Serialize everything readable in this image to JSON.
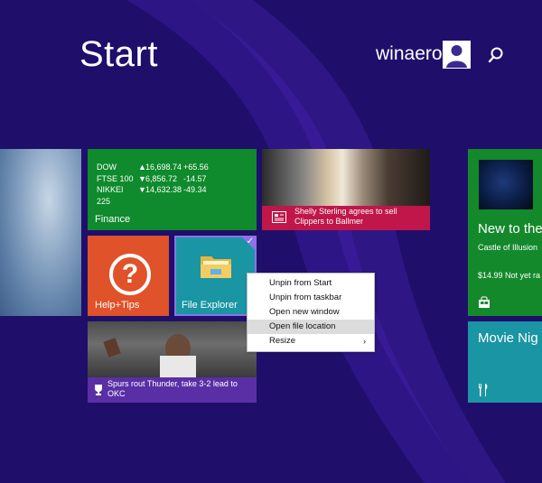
{
  "start": {
    "title": "Start"
  },
  "user": {
    "name": "winaero"
  },
  "tiles": {
    "finance": {
      "label": "Finance",
      "rows": [
        {
          "index": "DOW",
          "arrow": "▲",
          "value": "16,698.74",
          "change": "+65.56"
        },
        {
          "index": "FTSE 100",
          "arrow": "▼",
          "value": "6,856.72",
          "change": "-14.57"
        },
        {
          "index": "NIKKEI 225",
          "arrow": "▼",
          "value": "14,632.38",
          "change": "-49.34"
        }
      ]
    },
    "news": {
      "headline": "Shelly Sterling agrees to sell Clippers to Ballmer"
    },
    "help": {
      "label": "Help+Tips",
      "glyph": "?"
    },
    "file_explorer": {
      "label": "File Explorer",
      "selected_glyph": "✓"
    },
    "sports": {
      "headline": "Spurs rout Thunder, take 3-2 lead to OKC"
    },
    "store": {
      "headline": "New to the",
      "subtitle": "Castle of Illusion",
      "price": "$14.99 Not yet ra"
    },
    "movie": {
      "title": "Movie Nig"
    }
  },
  "context_menu": {
    "items": [
      {
        "label": "Unpin from Start"
      },
      {
        "label": "Unpin from taskbar"
      },
      {
        "label": "Open new window"
      },
      {
        "label": "Open file location"
      },
      {
        "label": "Resize",
        "submenu": "›"
      }
    ]
  },
  "colors": {
    "background": "#1f0f6b",
    "finance": "#0f8a2c",
    "news_bar": "#c0164a",
    "help": "#e0522a",
    "file_explorer": "#1a95a3",
    "selection": "#8c72e8",
    "sports": "#5a2fa5",
    "store": "#14892c"
  },
  "icons": [
    "search-icon",
    "avatar",
    "help-icon",
    "folder-icon",
    "checkmark-icon",
    "newspaper-icon",
    "trophy-icon",
    "store-bag-icon",
    "food-icon"
  ]
}
